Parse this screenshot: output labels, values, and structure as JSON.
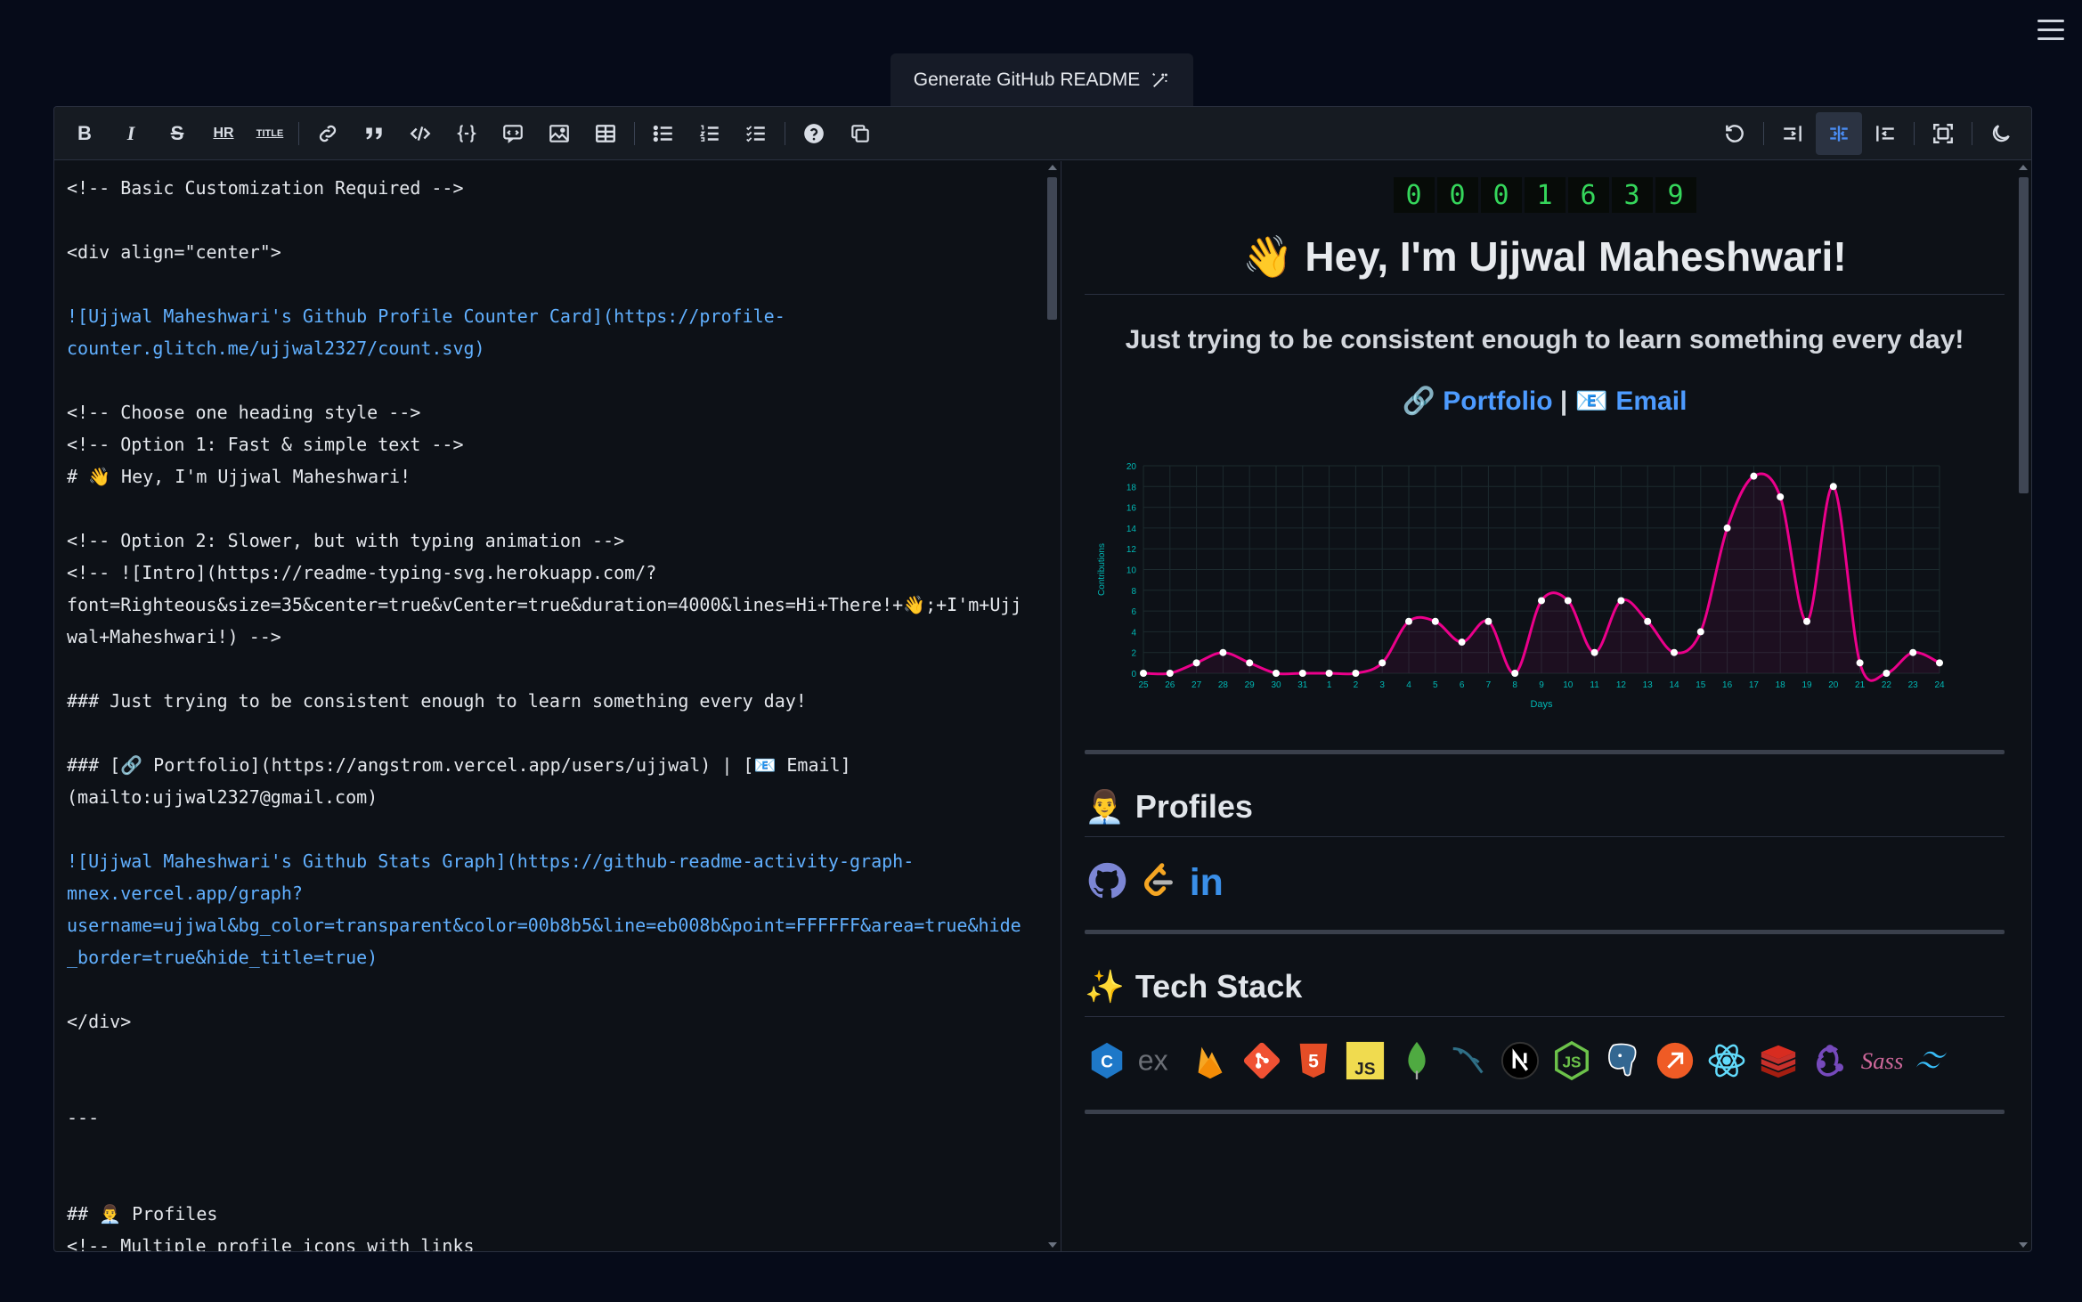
{
  "generate_button": {
    "label": "Generate GitHub README"
  },
  "toolbar": {
    "left": [
      {
        "name": "bold-button",
        "glyph": "B"
      },
      {
        "name": "italic-button",
        "glyph": "I"
      },
      {
        "name": "strikethrough-button",
        "glyph": "S"
      },
      {
        "name": "hr-button",
        "glyph": "HR"
      },
      {
        "name": "title-button",
        "glyph": "TITLE"
      }
    ]
  },
  "code_lines": [
    {
      "t": "<!-- Basic Customization Required -->"
    },
    {
      "t": ""
    },
    {
      "t": "<div align=\"center\">"
    },
    {
      "t": ""
    },
    {
      "t": "![Ujjwal Maheshwari's Github Profile Counter Card](https://profile-",
      "link": true
    },
    {
      "t": "counter.glitch.me/ujjwal2327/count.svg)",
      "link": true
    },
    {
      "t": ""
    },
    {
      "t": "<!-- Choose one heading style -->"
    },
    {
      "t": "<!-- Option 1: Fast & simple text -->"
    },
    {
      "t": "# 👋 Hey, I'm Ujjwal Maheshwari!"
    },
    {
      "t": ""
    },
    {
      "t": "<!-- Option 2: Slower, but with typing animation -->"
    },
    {
      "t": "<!-- ![Intro](https://readme-typing-svg.herokuapp.com/?"
    },
    {
      "t": "font=Righteous&size=35&center=true&vCenter=true&duration=4000&lines=Hi+There!+👋;+I'm+Ujj"
    },
    {
      "t": "wal+Maheshwari!) -->"
    },
    {
      "t": ""
    },
    {
      "t": "### Just trying to be consistent enough to learn something every day!"
    },
    {
      "t": ""
    },
    {
      "t": "### [🔗 Portfolio](https://angstrom.vercel.app/users/ujjwal) | [📧 Email]"
    },
    {
      "t": "(mailto:ujjwal2327@gmail.com)"
    },
    {
      "t": ""
    },
    {
      "t": "![Ujjwal Maheshwari's Github Stats Graph](https://github-readme-activity-graph-",
      "link": true
    },
    {
      "t": "mnex.vercel.app/graph?",
      "link": true
    },
    {
      "t": "username=ujjwal&bg_color=transparent&color=00b8b5&line=eb008b&point=FFFFFF&area=true&hide",
      "link": true
    },
    {
      "t": "_border=true&hide_title=true)",
      "link": true
    },
    {
      "t": ""
    },
    {
      "t": "</div>"
    },
    {
      "t": ""
    },
    {
      "t": ""
    },
    {
      "t": "---"
    },
    {
      "t": ""
    },
    {
      "t": ""
    },
    {
      "t": "## 👨‍💼 Profiles"
    },
    {
      "t": "<!-- Multiple profile icons with links"
    }
  ],
  "preview": {
    "counter_digits": [
      "0",
      "0",
      "0",
      "1",
      "6",
      "3",
      "9"
    ],
    "heading": "👋 Hey, I'm Ujjwal Maheshwari!",
    "subtitle": "Just trying to be consistent enough to learn something every day!",
    "portfolio_icon": "🔗",
    "portfolio": "Portfolio",
    "sep": "|",
    "email_icon": "📧",
    "email": "Email",
    "profiles_emoji": "👨‍💼",
    "profiles_title": "Profiles",
    "tech_emoji": "✨",
    "tech_title": "Tech Stack",
    "profile_icons": [
      "github-icon",
      "leetcode-icon",
      "linkedin-icon"
    ],
    "tech_icons": [
      "cpp-icon",
      "express-icon",
      "firebase-icon",
      "git-icon",
      "html5-icon",
      "javascript-icon",
      "mongodb-icon",
      "mysql-icon",
      "nextjs-icon",
      "nodejs-icon",
      "postgresql-icon",
      "postman-icon",
      "react-icon",
      "redis-icon",
      "redux-icon",
      "sass-icon",
      "tailwind-icon"
    ]
  },
  "chart_data": {
    "type": "line",
    "xlabel": "Days",
    "ylabel": "Contributions",
    "ylim": [
      0,
      20
    ],
    "yticks": [
      0,
      2,
      4,
      6,
      8,
      10,
      12,
      14,
      16,
      18,
      20
    ],
    "x": [
      "25",
      "26",
      "27",
      "28",
      "29",
      "30",
      "31",
      "1",
      "2",
      "3",
      "4",
      "5",
      "6",
      "7",
      "8",
      "9",
      "10",
      "11",
      "12",
      "13",
      "14",
      "15",
      "16",
      "17",
      "18",
      "19",
      "20",
      "21",
      "22",
      "23",
      "24"
    ],
    "values": [
      0,
      0,
      1,
      2,
      1,
      0,
      0,
      0,
      0,
      1,
      5,
      5,
      3,
      5,
      0,
      7,
      7,
      2,
      7,
      5,
      2,
      4,
      14,
      19,
      17,
      5,
      18,
      1,
      0,
      2,
      1
    ],
    "colors": {
      "line": "#eb008b",
      "point": "#FFFFFF",
      "axis": "#00b8b5"
    },
    "grid": true,
    "area": true
  }
}
